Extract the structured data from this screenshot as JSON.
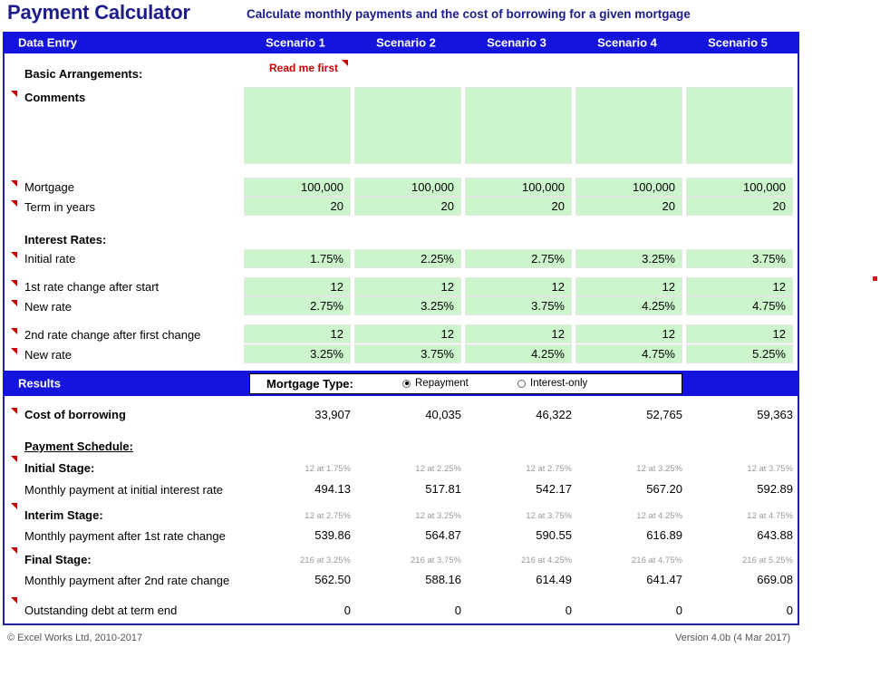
{
  "title": "Payment Calculator",
  "subtitle": "Calculate monthly payments and the cost of borrowing for a given mortgage",
  "colors": {
    "band": "#1414dc",
    "title": "#1c1c8c",
    "input_cell": "#ccf5cc",
    "alert": "#cc0000",
    "muted": "#9a9a9a"
  },
  "bands": {
    "data_entry": "Data Entry",
    "results": "Results"
  },
  "scenarios": [
    "Scenario 1",
    "Scenario 2",
    "Scenario 3",
    "Scenario 4",
    "Scenario 5"
  ],
  "notices": {
    "read_me_first": "Read me first"
  },
  "sections": {
    "basic_arrangements": "Basic Arrangements:",
    "interest_rates": "Interest Rates:",
    "payment_schedule": "Payment Schedule:"
  },
  "labels": {
    "comments": "Comments",
    "mortgage": "Mortgage",
    "term_in_years": "Term in years",
    "initial_rate": "Initial rate",
    "first_rate_change": "1st rate change after start",
    "new_rate_1": "New rate",
    "second_rate_change": "2nd rate change after first change",
    "new_rate_2": "New rate",
    "cost_of_borrowing": "Cost of borrowing",
    "initial_stage": "Initial Stage:",
    "monthly_initial": "Monthly payment at initial interest rate",
    "interim_stage": "Interim Stage:",
    "monthly_interim": "Monthly payment after 1st rate change",
    "final_stage": "Final Stage:",
    "monthly_final": "Monthly payment after 2nd rate change",
    "outstanding_debt": "Outstanding debt at term end"
  },
  "inputs": {
    "comments": [
      "",
      "",
      "",
      "",
      ""
    ],
    "mortgage": [
      "100,000",
      "100,000",
      "100,000",
      "100,000",
      "100,000"
    ],
    "term_in_years": [
      "20",
      "20",
      "20",
      "20",
      "20"
    ],
    "initial_rate": [
      "1.75%",
      "2.25%",
      "2.75%",
      "3.25%",
      "3.75%"
    ],
    "first_rate_change": [
      "12",
      "12",
      "12",
      "12",
      "12"
    ],
    "new_rate_1": [
      "2.75%",
      "3.25%",
      "3.75%",
      "4.25%",
      "4.75%"
    ],
    "second_rate_change": [
      "12",
      "12",
      "12",
      "12",
      "12"
    ],
    "new_rate_2": [
      "3.25%",
      "3.75%",
      "4.25%",
      "4.75%",
      "5.25%"
    ]
  },
  "mortgage_type": {
    "label": "Mortgage Type:",
    "options": [
      "Repayment",
      "Interest-only"
    ],
    "selected": "Repayment"
  },
  "results": {
    "cost_of_borrowing": [
      "33,907",
      "40,035",
      "46,322",
      "52,765",
      "59,363"
    ],
    "initial_stage_note": [
      "12 at 1.75%",
      "12 at 2.25%",
      "12 at 2.75%",
      "12 at 3.25%",
      "12 at 3.75%"
    ],
    "monthly_initial": [
      "494.13",
      "517.81",
      "542.17",
      "567.20",
      "592.89"
    ],
    "interim_stage_note": [
      "12 at 2.75%",
      "12 at 3.25%",
      "12 at 3.75%",
      "12 at 4.25%",
      "12 at 4.75%"
    ],
    "monthly_interim": [
      "539.86",
      "564.87",
      "590.55",
      "616.89",
      "643.88"
    ],
    "final_stage_note": [
      "216 at 3.25%",
      "216 at 3.75%",
      "216 at 4.25%",
      "216 at 4.75%",
      "216 at 5.25%"
    ],
    "monthly_final": [
      "562.50",
      "588.16",
      "614.49",
      "641.47",
      "669.08"
    ],
    "outstanding_debt": [
      "0",
      "0",
      "0",
      "0",
      "0"
    ]
  },
  "footer": {
    "copyright": "© Excel Works Ltd, 2010-2017",
    "version": "Version 4.0b (4 Mar 2017)"
  }
}
